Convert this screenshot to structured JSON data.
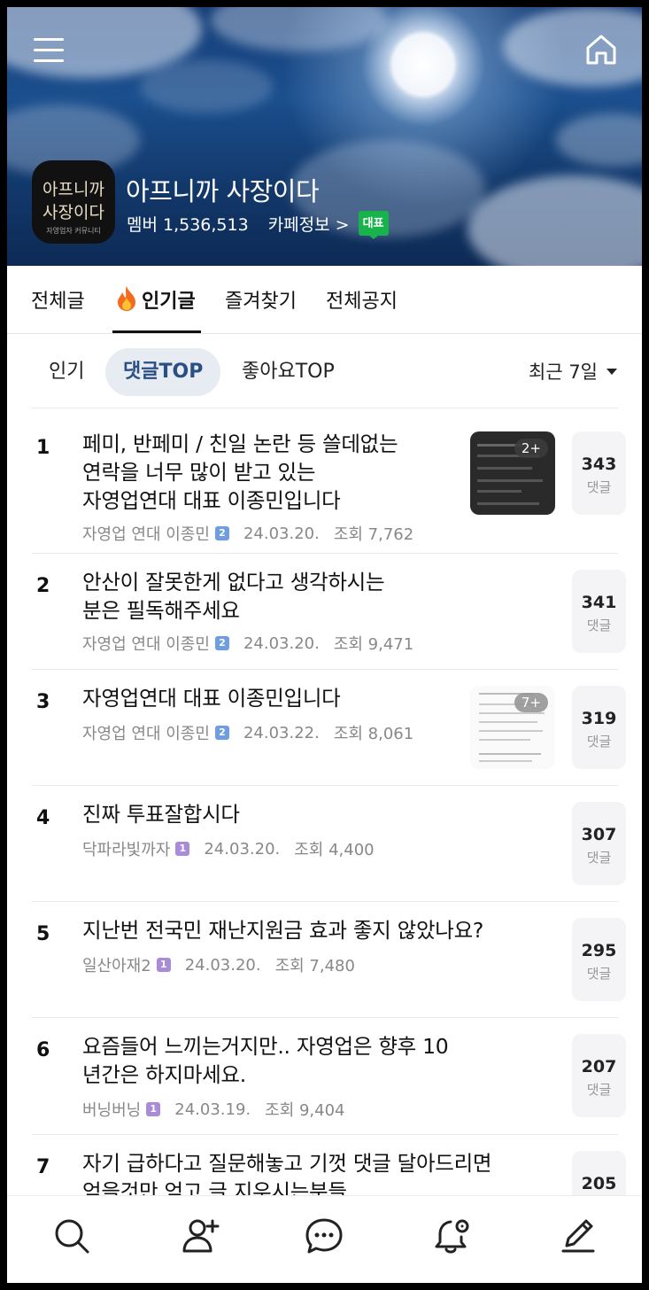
{
  "header": {
    "cafe_name": "아프니까 사장이다",
    "members_label": "멤버 1,536,513",
    "cafe_info_label": "카페정보 >",
    "rep_badge": "대표",
    "logo_line1": "아프니까",
    "logo_line2": "사장이다",
    "logo_sub": "자영업자 커뮤니티"
  },
  "tabs": [
    {
      "label": "전체글"
    },
    {
      "label": "인기글",
      "icon": "fire-icon",
      "active": true
    },
    {
      "label": "즐겨찾기"
    },
    {
      "label": "전체공지"
    }
  ],
  "filters": [
    {
      "label": "인기"
    },
    {
      "label": "댓글TOP",
      "active": true
    },
    {
      "label": "좋아요TOP"
    }
  ],
  "period": "최근 7일",
  "comment_unit": "댓글",
  "posts": [
    {
      "rank": "1",
      "title": "페미, 반페미 / 친일 논란 등 쓸데없는\n연락을 너무 많이 받고 있는\n자영업연대 대표 이종민입니다",
      "author": "자영업 연대 이종민",
      "level": "2",
      "date": "24.03.20.",
      "views": "조회 7,762",
      "comments": "343",
      "thumb_more": "2+"
    },
    {
      "rank": "2",
      "title": "안산이 잘못한게 없다고 생각하시는\n분은 필독해주세요",
      "author": "자영업 연대 이종민",
      "level": "2",
      "date": "24.03.20.",
      "views": "조회 9,471",
      "comments": "341"
    },
    {
      "rank": "3",
      "title": "자영업연대 대표 이종민입니다",
      "author": "자영업 연대 이종민",
      "level": "2",
      "date": "24.03.22.",
      "views": "조회 8,061",
      "comments": "319",
      "thumb_more": "7+"
    },
    {
      "rank": "4",
      "title": "진짜 투표잘합시다",
      "author": "닥파라빛까자",
      "level": "1",
      "date": "24.03.20.",
      "views": "조회 4,400",
      "comments": "307"
    },
    {
      "rank": "5",
      "title": "지난번 전국민 재난지원금 효과 좋지 않았나요?",
      "author": "일산아재2",
      "level": "1",
      "date": "24.03.20.",
      "views": "조회 7,480",
      "comments": "295"
    },
    {
      "rank": "6",
      "title": "요즘들어 느끼는거지만.. 자영업은 향후 10\n년간은 하지마세요.",
      "author": "버닝버닝",
      "level": "1",
      "date": "24.03.19.",
      "views": "조회 9,404",
      "comments": "207"
    },
    {
      "rank": "7",
      "title": "자기 급하다고 질문해놓고 기껏 댓글 달아드리면\n얻을것만 얻고 글 지우시는분들",
      "author": "",
      "level": "",
      "date": "",
      "views": "",
      "comments": "205"
    }
  ],
  "colors": {
    "level2": "#6e9ee0",
    "level1": "#a98bd8",
    "rep_badge": "#19b34d",
    "filter_active_bg": "#e7ebf2"
  },
  "bottom_nav": [
    {
      "icon": "search-icon"
    },
    {
      "icon": "add-friend-icon"
    },
    {
      "icon": "chat-icon"
    },
    {
      "icon": "notification-settings-icon"
    },
    {
      "icon": "write-icon"
    }
  ]
}
